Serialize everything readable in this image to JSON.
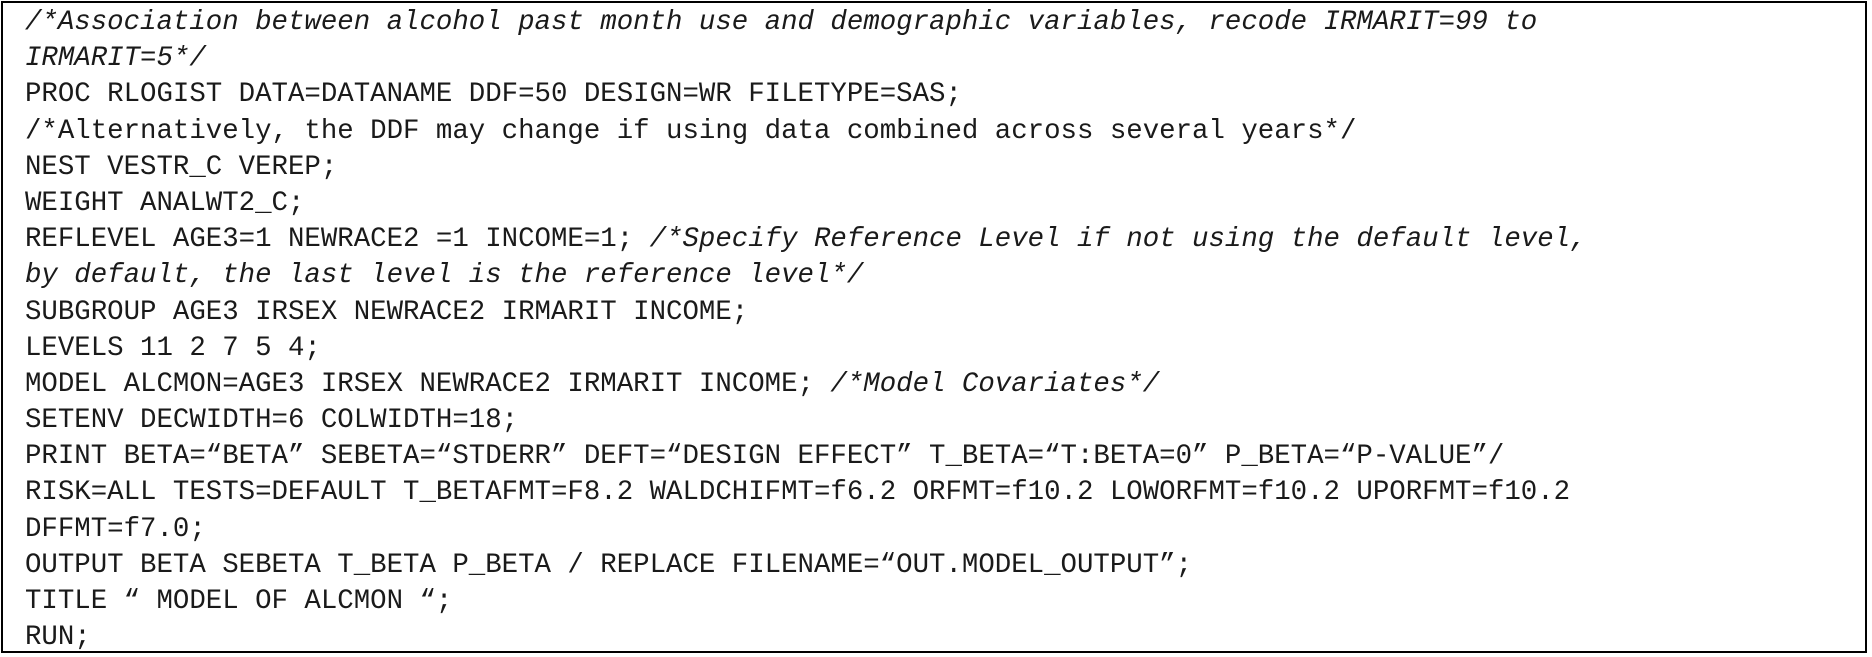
{
  "code": {
    "lines": [
      {
        "code": "",
        "comment": "/*Association between alcohol past month use and demographic variables, recode IRMARIT=99 to"
      },
      {
        "code": "",
        "comment": "IRMARIT=5*/"
      },
      {
        "code": "PROC RLOGIST DATA=DATANAME DDF=50 DESIGN=WR FILETYPE=SAS;",
        "comment": ""
      },
      {
        "code": "/*Alternatively, the DDF may change if using data combined across several years*/",
        "comment": ""
      },
      {
        "code": "NEST VESTR_C VEREP;",
        "comment": ""
      },
      {
        "code": "WEIGHT ANALWT2_C;",
        "comment": ""
      },
      {
        "code": "REFLEVEL AGE3=1 NEWRACE2 =1 INCOME=1; ",
        "comment": "/*Specify Reference Level if not using the default level,"
      },
      {
        "code": "",
        "comment": "by default, the last level is the reference level*/"
      },
      {
        "code": "SUBGROUP AGE3 IRSEX NEWRACE2 IRMARIT INCOME;",
        "comment": ""
      },
      {
        "code": "LEVELS 11 2 7 5 4;",
        "comment": ""
      },
      {
        "code": "MODEL ALCMON=AGE3 IRSEX NEWRACE2 IRMARIT INCOME; ",
        "comment": "/*Model Covariates*/"
      },
      {
        "code": "SETENV DECWIDTH=6 COLWIDTH=18;",
        "comment": ""
      },
      {
        "code": "PRINT BETA=“BETA” SEBETA=“STDERR” DEFT=“DESIGN EFFECT” T_BETA=“T:BETA=0” P_BETA=“P-VALUE”/",
        "comment": ""
      },
      {
        "code": "RISK=ALL TESTS=DEFAULT T_BETAFMT=F8.2 WALDCHIFMT=f6.2 ORFMT=f10.2 LOWORFMT=f10.2 UPORFMT=f10.2",
        "comment": ""
      },
      {
        "code": "DFFMT=f7.0;",
        "comment": ""
      },
      {
        "code": "OUTPUT BETA SEBETA T_BETA P_BETA / REPLACE FILENAME=“OUT.MODEL_OUTPUT”;",
        "comment": ""
      },
      {
        "code": "TITLE “ MODEL OF ALCMON “;",
        "comment": ""
      },
      {
        "code": "RUN;",
        "comment": ""
      }
    ]
  }
}
